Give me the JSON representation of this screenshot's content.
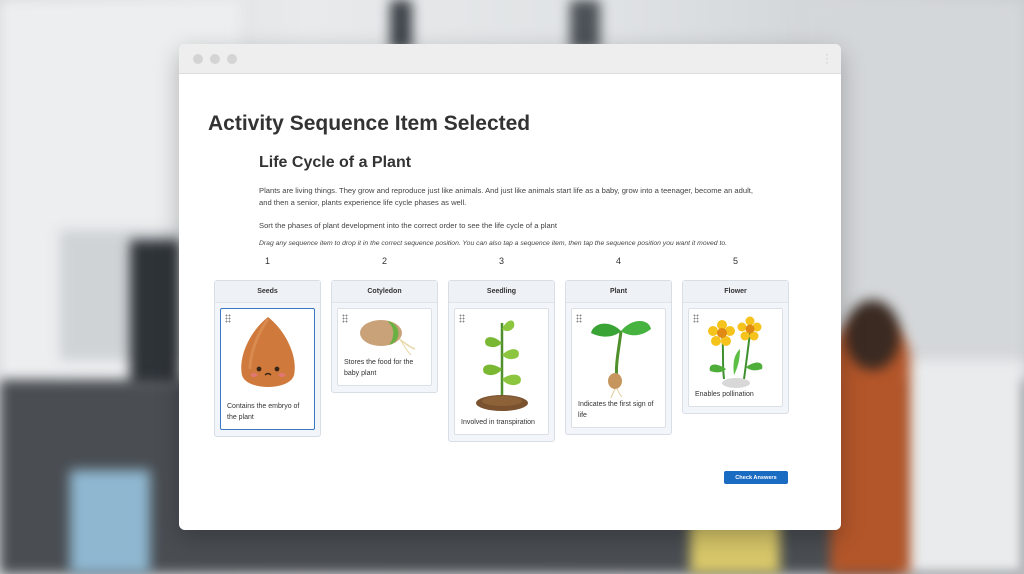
{
  "page": {
    "heading": "Activity Sequence Item Selected"
  },
  "activity": {
    "title": "Life Cycle of a Plant",
    "description": "Plants are living things. They grow and reproduce just like animals. And just like animals start life as a baby, grow into a teenager, become an adult, and then a senior, plants experience life cycle phases as well.",
    "instruction": "Sort the phases of plant development into the correct order to see the life cycle of a plant",
    "hint": "Drag any sequence item to drop it in the correct sequence position. You can also tap a sequence item, then tap the sequence position you want it moved to."
  },
  "slots": [
    {
      "number": "1",
      "label": "Seeds",
      "item_text": "Contains the embryo of the plant",
      "icon": "seed-icon",
      "selected": true
    },
    {
      "number": "2",
      "label": "Cotyledon",
      "item_text": "Stores the food for the baby plant",
      "icon": "cotyledon-icon",
      "selected": false
    },
    {
      "number": "3",
      "label": "Seedling",
      "item_text": "Involved in transpiration",
      "icon": "seedling-icon",
      "selected": false
    },
    {
      "number": "4",
      "label": "Plant",
      "item_text": "Indicates the first sign of life",
      "icon": "sprout-icon",
      "selected": false
    },
    {
      "number": "5",
      "label": "Flower",
      "item_text": "Enables pollination",
      "icon": "flower-icon",
      "selected": false
    }
  ],
  "actions": {
    "check_answers": "Check Answers"
  },
  "colors": {
    "accent": "#1a6bc2",
    "selected_border": "#3a78c2"
  }
}
